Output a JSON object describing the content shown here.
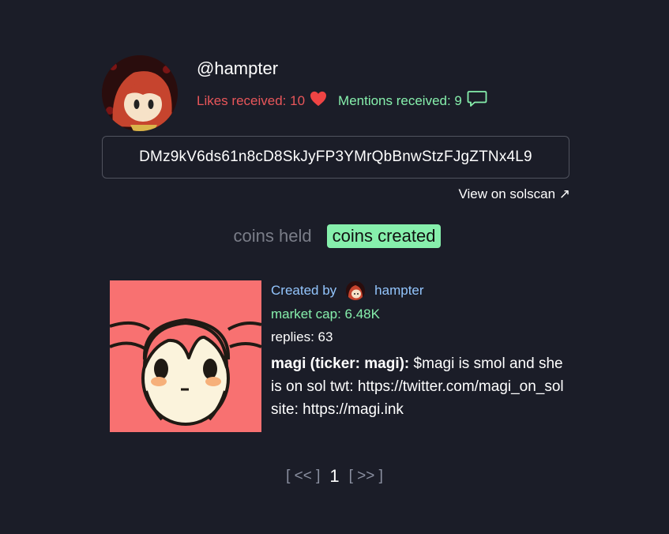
{
  "profile": {
    "username": "@hampter",
    "likes_label": "Likes received: 10",
    "mentions_label": "Mentions received: 9",
    "address": "DMz9kV6ds61n8cD8SkJyFP3YMrQbBnwStzFJgZTNx4L9",
    "solscan_label": "View on solscan ↗"
  },
  "tabs": [
    {
      "label": "coins held",
      "active": false
    },
    {
      "label": "coins created",
      "active": true
    }
  ],
  "coin": {
    "created_by_label": "Created by",
    "creator_name": "hampter",
    "market_cap": "market cap: 6.48K",
    "replies": "replies: 63",
    "title": "magi (ticker: magi):",
    "description": " $magi is smol and she is on sol twt: https://twitter.com/magi_on_sol site: https://magi.ink"
  },
  "pagination": {
    "prev": "[ << ]",
    "current": "1",
    "next": "[ >> ]"
  },
  "colors": {
    "background": "#1b1d28",
    "likes": "#e8565a",
    "accent_green": "#86efac",
    "link_blue": "#93c5fd",
    "coin_bg": "#f87171"
  },
  "icons": [
    "heart-icon",
    "chat-bubble-icon"
  ]
}
